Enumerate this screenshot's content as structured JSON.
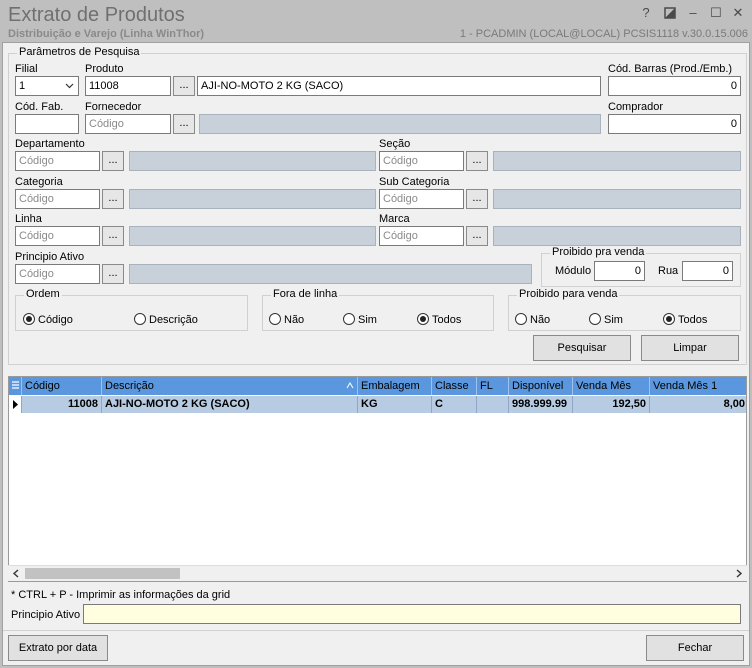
{
  "window": {
    "title": "Extrato de Produtos",
    "subtitle": "Distribuição e Varejo (Linha WinThor)",
    "status": "1 - PCADMIN (LOCAL@LOCAL)   PCSIS1118  v.30.0.15.006",
    "btn_help": "?",
    "btn_min": "–",
    "btn_max": "☐",
    "btn_close": "✕"
  },
  "params": {
    "group_label": "Parâmetros de Pesquisa",
    "filial_label": "Filial",
    "filial_value": "1",
    "produto_label": "Produto",
    "produto_code": "11008",
    "produto_desc": "AJI-NO-MOTO 2 KG (SACO)",
    "cod_barras_label": "Cód. Barras (Prod./Emb.)",
    "cod_barras_value": "0",
    "cod_fab_label": "Cód. Fab.",
    "fornecedor_label": "Fornecedor",
    "comprador_label": "Comprador",
    "comprador_value": "0",
    "departamento_label": "Departamento",
    "secao_label": "Seção",
    "categoria_label": "Categoria",
    "subcategoria_label": "Sub Categoria",
    "linha_label": "Linha",
    "marca_label": "Marca",
    "principio_label": "Principio Ativo",
    "placeholder": "Código",
    "dots": "..."
  },
  "proibido_box": {
    "title": "Proibido pra venda",
    "modulo_label": "Módulo",
    "modulo_value": "0",
    "rua_label": "Rua",
    "rua_value": "0"
  },
  "ordem": {
    "title": "Ordem",
    "opt1": "Código",
    "opt2": "Descrição"
  },
  "fora_linha": {
    "title": "Fora de linha",
    "opt1": "Não",
    "opt2": "Sim",
    "opt3": "Todos"
  },
  "proibido_radio": {
    "title": "Proibido para venda",
    "opt1": "Não",
    "opt2": "Sim",
    "opt3": "Todos"
  },
  "buttons": {
    "pesquisar": "Pesquisar",
    "limpar": "Limpar",
    "extrato": "Extrato por data",
    "fechar": "Fechar"
  },
  "grid": {
    "columns": [
      "Código",
      "Descrição",
      "Embalagem",
      "Classe",
      "FL",
      "Disponível",
      "Venda Mês",
      "Venda Mês 1"
    ],
    "row": [
      "11008",
      "AJI-NO-MOTO 2 KG (SACO)",
      "KG",
      "C",
      "",
      "998.999.99",
      "192,50",
      "8,00"
    ]
  },
  "footer": {
    "hint": "* CTRL + P - Imprimir as informações da grid",
    "principio_label": "Principio Ativo"
  },
  "colors": {
    "header_blue": "#5b97de",
    "row_selected": "#b7cbe3",
    "disabled_field": "#c8d0d9",
    "principio_field": "#ffffe0"
  }
}
